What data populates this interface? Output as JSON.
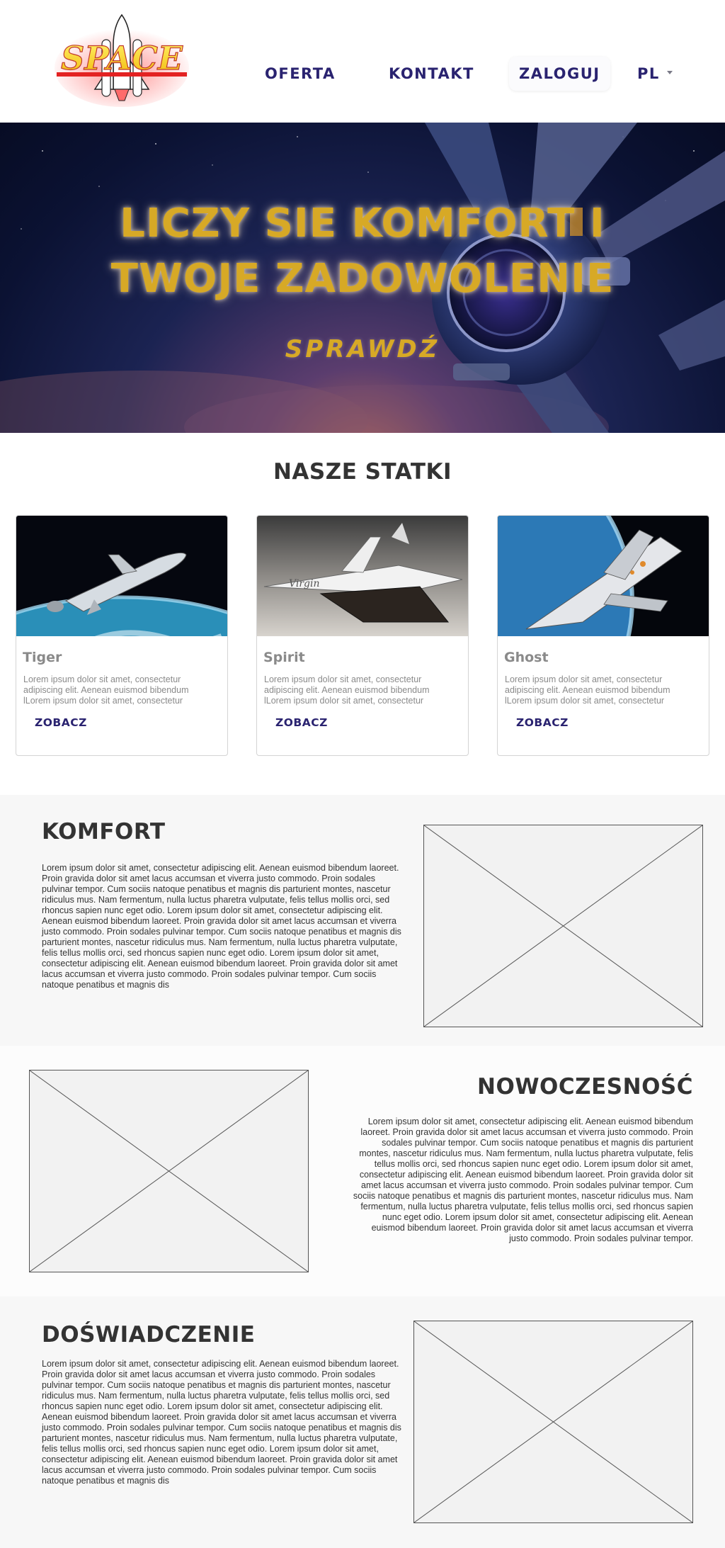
{
  "header": {
    "logo_text": "SPACE",
    "nav": {
      "offer": "OFERTA",
      "contact": "KONTAKT",
      "login": "ZALOGUJ",
      "language": "PL"
    }
  },
  "hero": {
    "title_line1": "LICZY SIE KOMFORT I",
    "title_line2": "TWOJE ZADOWOLENIE",
    "cta": "SPRAWDŹ"
  },
  "ships": {
    "title": "NASZE STATKI",
    "cards": [
      {
        "name": "Tiger",
        "text": "Lorem ipsum dolor sit amet, consectetur adipiscing elit. Aenean euismod bibendum lLorem ipsum dolor sit amet, consectetur",
        "button": "ZOBACZ"
      },
      {
        "name": "Spirit",
        "text": "Lorem ipsum dolor sit amet, consectetur adipiscing elit. Aenean euismod bibendum lLorem ipsum dolor sit amet, consectetur",
        "button": "ZOBACZ"
      },
      {
        "name": "Ghost",
        "text": "Lorem ipsum dolor sit amet, consectetur adipiscing elit. Aenean euismod bibendum lLorem ipsum dolor sit amet, consectetur",
        "button": "ZOBACZ"
      }
    ]
  },
  "features": [
    {
      "title": "KOMFORT",
      "text": "Lorem ipsum dolor sit amet, consectetur adipiscing elit. Aenean euismod bibendum laoreet. Proin gravida dolor sit amet lacus accumsan et viverra justo commodo. Proin sodales pulvinar tempor. Cum sociis natoque penatibus et magnis dis parturient montes, nascetur ridiculus mus. Nam fermentum, nulla luctus pharetra vulputate, felis tellus mollis orci, sed rhoncus sapien nunc eget odio. Lorem ipsum dolor sit amet, consectetur adipiscing elit. Aenean euismod bibendum laoreet. Proin gravida dolor sit amet lacus accumsan et viverra justo commodo. Proin sodales pulvinar tempor. Cum sociis natoque penatibus et magnis dis parturient montes, nascetur ridiculus mus. Nam fermentum, nulla luctus pharetra vulputate, felis tellus mollis orci, sed rhoncus sapien nunc eget odio. Lorem ipsum dolor sit amet, consectetur adipiscing elit. Aenean euismod bibendum laoreet. Proin gravida dolor sit amet lacus accumsan et viverra justo commodo. Proin sodales pulvinar tempor. Cum sociis natoque penatibus et magnis dis"
    },
    {
      "title": "NOWOCZESNOŚĆ",
      "text": "Lorem ipsum dolor sit amet, consectetur adipiscing elit. Aenean euismod bibendum laoreet. Proin gravida dolor sit amet lacus accumsan et viverra justo commodo. Proin sodales pulvinar tempor. Cum sociis natoque penatibus et magnis dis parturient montes, nascetur ridiculus mus. Nam fermentum, nulla luctus pharetra vulputate, felis tellus mollis orci, sed rhoncus sapien nunc eget odio. Lorem ipsum dolor sit amet, consectetur adipiscing elit. Aenean euismod bibendum laoreet. Proin gravida dolor sit amet lacus accumsan et viverra justo commodo. Proin sodales pulvinar tempor. Cum sociis natoque penatibus et magnis dis parturient montes, nascetur ridiculus mus. Nam fermentum, nulla luctus pharetra vulputate, felis tellus mollis orci, sed rhoncus sapien nunc eget odio. Lorem ipsum dolor sit amet, consectetur adipiscing elit. Aenean euismod bibendum laoreet. Proin gravida dolor sit amet lacus accumsan et viverra justo commodo. Proin sodales pulvinar tempor."
    },
    {
      "title": "DOŚWIADCZENIE",
      "text": "Lorem ipsum dolor sit amet, consectetur adipiscing elit. Aenean euismod bibendum laoreet. Proin gravida dolor sit amet lacus accumsan et viverra justo commodo. Proin sodales pulvinar tempor. Cum sociis natoque penatibus et magnis dis parturient montes, nascetur ridiculus mus. Nam fermentum, nulla luctus pharetra vulputate, felis tellus mollis orci, sed rhoncus sapien nunc eget odio. Lorem ipsum dolor sit amet, consectetur adipiscing elit. Aenean euismod bibendum laoreet. Proin gravida dolor sit amet lacus accumsan et viverra justo commodo. Proin sodales pulvinar tempor. Cum sociis natoque penatibus et magnis dis parturient montes, nascetur ridiculus mus. Nam fermentum, nulla luctus pharetra vulputate, felis tellus mollis orci, sed rhoncus sapien nunc eget odio. Lorem ipsum dolor sit amet, consectetur adipiscing elit. Aenean euismod bibendum laoreet. Proin gravida dolor sit amet lacus accumsan et viverra justo commodo. Proin sodales pulvinar tempor. Cum sociis natoque penatibus et magnis dis"
    }
  ],
  "colors": {
    "nav_text": "#2a2370",
    "hero_gold": "#d7a926",
    "heading": "#333333",
    "muted": "#8a8a8a",
    "section_bg_alt": "#f7f7f7"
  },
  "icons": [
    "logo-image",
    "chevron-down-icon",
    "image-placeholder-icon"
  ]
}
